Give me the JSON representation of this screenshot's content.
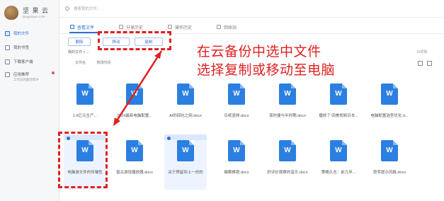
{
  "app": {
    "brand": "坚 果 云",
    "domain": "jianguoyun.com"
  },
  "sidebar": {
    "items": [
      {
        "label": "我的文件",
        "active": true
      },
      {
        "label": "我的书签",
        "active": false
      },
      {
        "label": "下载客户端",
        "active": false
      },
      {
        "label": "应用推荐",
        "active": false
      }
    ],
    "sub_text": "工作日的最佳帮手"
  },
  "search": {
    "placeholder": "搜索我的文件..."
  },
  "tabs": [
    {
      "label": "查看文件",
      "active": true
    },
    {
      "label": "分享历史",
      "active": false
    },
    {
      "label": "操作历史",
      "active": false
    },
    {
      "label": "回收站",
      "active": false
    }
  ],
  "toolbar": {
    "delete_label": "删除",
    "move_label": "移动",
    "copy_label": "复制"
  },
  "breadcrumb": "我的文件  >  ...",
  "item_count": "15项数",
  "sort": {
    "name_label": "文件名",
    "time_label": "修改时间"
  },
  "files": [
    {
      "name": "1.6亿元生产...",
      "selected": false
    },
    {
      "name": "2024最新电脑配置...",
      "selected": false
    },
    {
      "name": "AI的回化之网.docx",
      "selected": false
    },
    {
      "name": "日纸混排.docx",
      "selected": false
    },
    {
      "name": "保时捷与半时期.docx",
      "selected": false
    },
    {
      "name": "播放了 回美视频日本...",
      "selected": false
    },
    {
      "name": "电脑配置选型优化.d...",
      "selected": false
    },
    {
      "name": "电脑游文件的传输性",
      "selected": true
    },
    {
      "name": "窗古游戏播放器.docx",
      "selected": false
    },
    {
      "name": "关于预留到上一份的",
      "selected": true
    },
    {
      "name": "编案推销.docx",
      "selected": false
    },
    {
      "name": "好评价观察的音乐.docx",
      "selected": false
    },
    {
      "name": "策略久志：前几年...",
      "selected": false
    },
    {
      "name": "获奖提示风格.docx",
      "selected": false
    }
  ],
  "doc_icon_letter": "W",
  "annotation": {
    "line1": "在云备份中选中文件",
    "line2": "选择复制或移动至电脑",
    "color": "#e01f1f"
  },
  "colors": {
    "accent": "#2f6fd6",
    "doc": "#2b7fe0"
  }
}
